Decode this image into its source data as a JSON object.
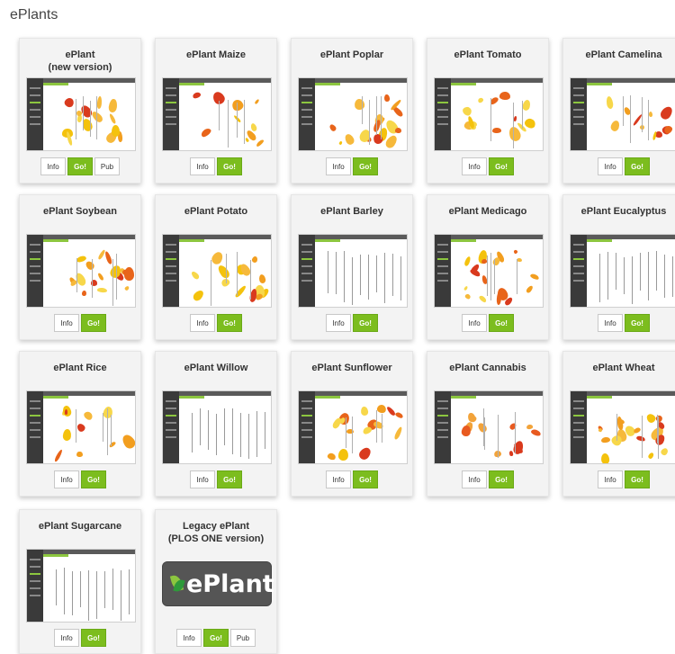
{
  "page_title": "ePlants",
  "cards": [
    {
      "title": "ePlant\n(new version)",
      "buttons": [
        "Info",
        "Go!",
        "Pub"
      ]
    },
    {
      "title": "ePlant Maize",
      "buttons": [
        "Info",
        "Go!"
      ]
    },
    {
      "title": "ePlant Poplar",
      "buttons": [
        "Info",
        "Go!"
      ]
    },
    {
      "title": "ePlant Tomato",
      "buttons": [
        "Info",
        "Go!"
      ]
    },
    {
      "title": "ePlant Camelina",
      "buttons": [
        "Info",
        "Go!"
      ]
    },
    {
      "title": "ePlant Soybean",
      "buttons": [
        "Info",
        "Go!"
      ]
    },
    {
      "title": "ePlant Potato",
      "buttons": [
        "Info",
        "Go!"
      ]
    },
    {
      "title": "ePlant Barley",
      "buttons": [
        "Info",
        "Go!"
      ]
    },
    {
      "title": "ePlant Medicago",
      "buttons": [
        "Info",
        "Go!"
      ]
    },
    {
      "title": "ePlant Eucalyptus",
      "buttons": [
        "Info",
        "Go!"
      ]
    },
    {
      "title": "ePlant Rice",
      "buttons": [
        "Info",
        "Go!"
      ]
    },
    {
      "title": "ePlant Willow",
      "buttons": [
        "Info",
        "Go!"
      ]
    },
    {
      "title": "ePlant Sunflower",
      "buttons": [
        "Info",
        "Go!"
      ]
    },
    {
      "title": "ePlant Cannabis",
      "buttons": [
        "Info",
        "Go!"
      ]
    },
    {
      "title": "ePlant Wheat",
      "buttons": [
        "Info",
        "Go!"
      ]
    },
    {
      "title": "ePlant Sugarcane",
      "buttons": [
        "Info",
        "Go!"
      ]
    },
    {
      "title": "Legacy ePlant\n(PLOS ONE version)",
      "buttons": [
        "Info",
        "Go!",
        "Pub"
      ],
      "logo_text": "ePlant"
    }
  ],
  "colors": {
    "go": "#7cbd1e",
    "card_bg": "#f3f3f3"
  }
}
